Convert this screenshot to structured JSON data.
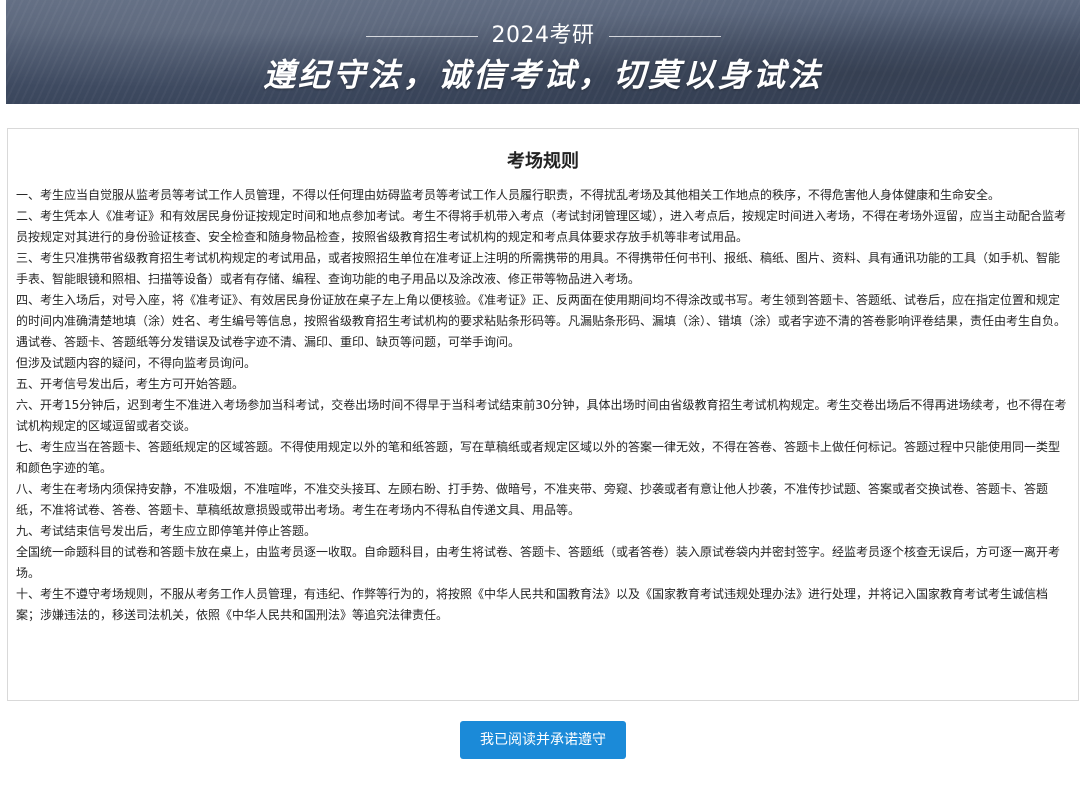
{
  "banner": {
    "year_text": "2024考研",
    "slogan": "遵纪守法，诚信考试，切莫以身试法"
  },
  "rules": {
    "title": "考场规则",
    "paragraphs": [
      "一、考生应当自觉服从监考员等考试工作人员管理，不得以任何理由妨碍监考员等考试工作人员履行职责，不得扰乱考场及其他相关工作地点的秩序，不得危害他人身体健康和生命安全。",
      "二、考生凭本人《准考证》和有效居民身份证按规定时间和地点参加考试。考生不得将手机带入考点（考试封闭管理区域），进入考点后，按规定时间进入考场，不得在考场外逗留，应当主动配合监考员按规定对其进行的身份验证核查、安全检查和随身物品检查，按照省级教育招生考试机构的规定和考点具体要求存放手机等非考试用品。",
      "三、考生只准携带省级教育招生考试机构规定的考试用品，或者按照招生单位在准考证上注明的所需携带的用具。不得携带任何书刊、报纸、稿纸、图片、资料、具有通讯功能的工具（如手机、智能手表、智能眼镜和照相、扫描等设备）或者有存储、编程、查询功能的电子用品以及涂改液、修正带等物品进入考场。",
      "四、考生入场后，对号入座，将《准考证》、有效居民身份证放在桌子左上角以便核验。《准考证》正、反两面在使用期间均不得涂改或书写。考生领到答题卡、答题纸、试卷后，应在指定位置和规定的时间内准确清楚地填（涂）姓名、考生编号等信息，按照省级教育招生考试机构的要求粘贴条形码等。凡漏贴条形码、漏填（涂）、错填（涂）或者字迹不清的答卷影响评卷结果，责任由考生自负。遇试卷、答题卡、答题纸等分发错误及试卷字迹不清、漏印、重印、缺页等问题，可举手询问。",
      "但涉及试题内容的疑问，不得向监考员询问。",
      "五、开考信号发出后，考生方可开始答题。",
      "六、开考15分钟后，迟到考生不准进入考场参加当科考试，交卷出场时间不得早于当科考试结束前30分钟，具体出场时间由省级教育招生考试机构规定。考生交卷出场后不得再进场续考，也不得在考试机构规定的区域逗留或者交谈。",
      "七、考生应当在答题卡、答题纸规定的区域答题。不得使用规定以外的笔和纸答题，写在草稿纸或者规定区域以外的答案一律无效，不得在答卷、答题卡上做任何标记。答题过程中只能使用同一类型和颜色字迹的笔。",
      "八、考生在考场内须保持安静，不准吸烟，不准喧哗，不准交头接耳、左顾右盼、打手势、做暗号，不准夹带、旁窥、抄袭或者有意让他人抄袭，不准传抄试题、答案或者交换试卷、答题卡、答题纸，不准将试卷、答卷、答题卡、草稿纸故意损毁或带出考场。考生在考场内不得私自传递文具、用品等。",
      "九、考试结束信号发出后，考生应立即停笔并停止答题。",
      "全国统一命题科目的试卷和答题卡放在桌上，由监考员逐一收取。自命题科目，由考生将试卷、答题卡、答题纸（或者答卷）装入原试卷袋内并密封签字。经监考员逐个核查无误后，方可逐一离开考场。",
      "十、考生不遵守考场规则，不服从考务工作人员管理，有违纪、作弊等行为的，将按照《中华人民共和国教育法》以及《国家教育考试违规处理办法》进行处理，并将记入国家教育考试考生诚信档案；涉嫌违法的，移送司法机关，依照《中华人民共和国刑法》等追究法律责任。"
    ]
  },
  "confirm_button": {
    "label": "我已阅读并承诺遵守"
  },
  "colors": {
    "banner_bg": "#48546b",
    "button_bg": "#1b8ad8",
    "panel_border": "#d9d9d9"
  }
}
